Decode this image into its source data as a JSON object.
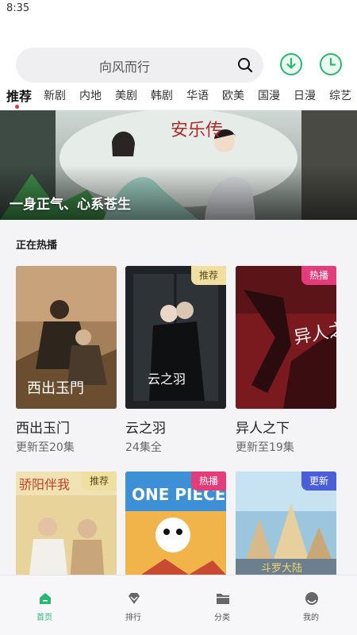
{
  "status_bar": {
    "time": "8:35"
  },
  "search": {
    "text": "向风而行"
  },
  "icons": {
    "search": "search-icon",
    "download": "download-icon",
    "history": "clock-icon",
    "home": "home-icon",
    "ranking": "diamond-icon",
    "category": "folder-icon",
    "mine": "user-icon"
  },
  "colors": {
    "accent": "#2bb673",
    "badge_hot": "#e23d7a",
    "badge_new": "#4a5fd7",
    "badge_recommend": "#efe0a2"
  },
  "tabs": [
    {
      "label": "推荐",
      "active": true
    },
    {
      "label": "新剧"
    },
    {
      "label": "内地"
    },
    {
      "label": "美剧"
    },
    {
      "label": "韩剧"
    },
    {
      "label": "华语"
    },
    {
      "label": "欧美"
    },
    {
      "label": "国漫"
    },
    {
      "label": "日漫"
    },
    {
      "label": "综艺"
    }
  ],
  "banner": {
    "caption": "一身正气、心系苍生",
    "poster_title": "安乐传"
  },
  "section": {
    "title": "正在热播"
  },
  "cards": [
    {
      "title": "西出玉门",
      "subtitle": "更新至20集",
      "badge": "",
      "poster_text": "西出玉門"
    },
    {
      "title": "云之羽",
      "subtitle": "24集全",
      "badge": "推荐",
      "poster_text": "云之羽"
    },
    {
      "title": "异人之下",
      "subtitle": "更新至19集",
      "badge": "热播",
      "poster_text": "异人之下"
    },
    {
      "title": "",
      "subtitle": "",
      "badge": "推荐",
      "poster_text": "骄阳伴我"
    },
    {
      "title": "",
      "subtitle": "",
      "badge": "热播",
      "poster_text": "ONE PIECE"
    },
    {
      "title": "",
      "subtitle": "",
      "badge": "更新",
      "poster_text": "斗罗大陆"
    }
  ],
  "bottom_nav": [
    {
      "label": "首页",
      "active": true
    },
    {
      "label": "排行"
    },
    {
      "label": "分类"
    },
    {
      "label": "我的"
    }
  ]
}
